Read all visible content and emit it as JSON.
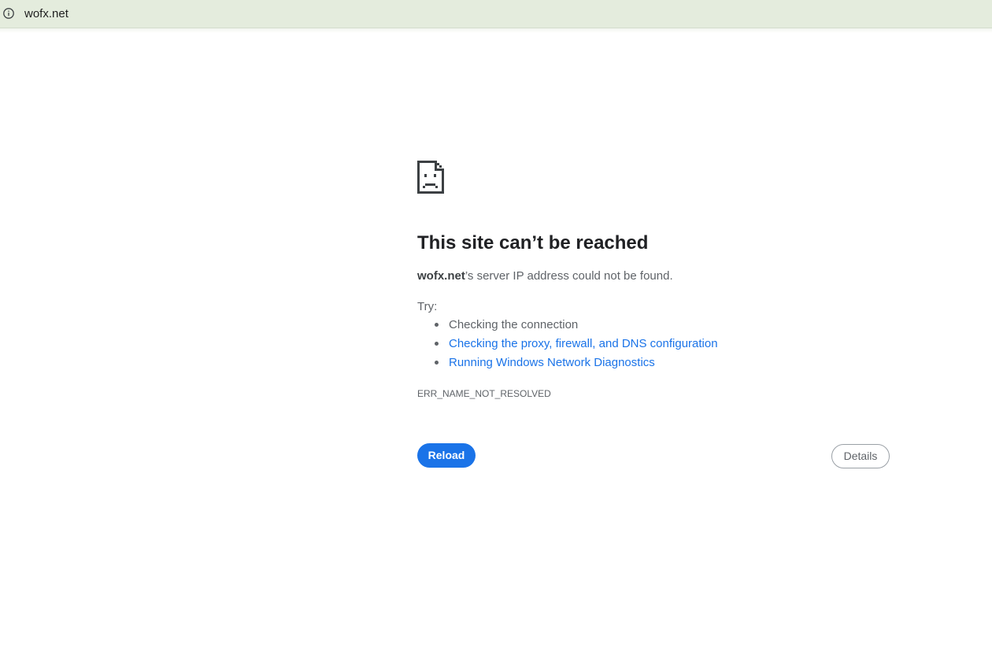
{
  "address_bar": {
    "url": "wofx.net",
    "site_info_icon": "info-circle-icon",
    "background": "#e4ecdd"
  },
  "error_page": {
    "icon": "sad-document-icon",
    "title": "This site can’t be reached",
    "summary": {
      "domain": "wofx.net",
      "message": "’s server IP address could not be found."
    },
    "try_label": "Try:",
    "suggestions": [
      {
        "label": "Checking the connection",
        "is_link": false
      },
      {
        "label": "Checking the proxy, firewall, and DNS configuration",
        "is_link": true
      },
      {
        "label": "Running Windows Network Diagnostics",
        "is_link": true
      }
    ],
    "error_code": "ERR_NAME_NOT_RESOLVED",
    "reload_label": "Reload",
    "details_label": "Details"
  },
  "colors": {
    "accent": "#1a73e8",
    "text_primary": "#202124",
    "text_secondary": "#5f6368"
  }
}
